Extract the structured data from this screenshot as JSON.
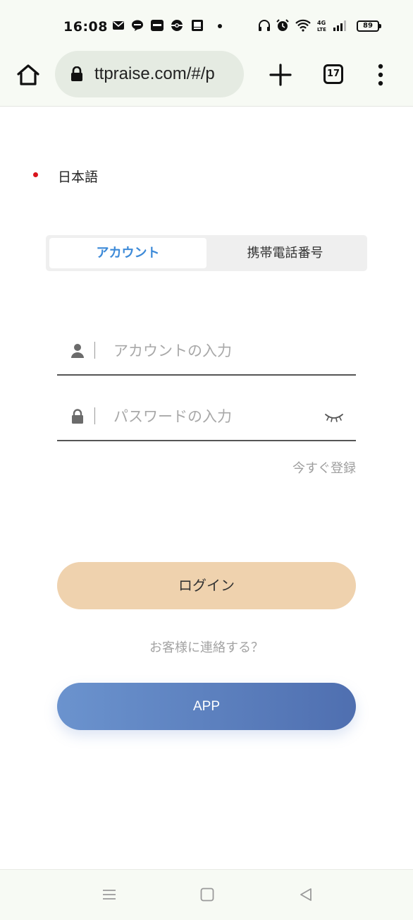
{
  "status_bar": {
    "time": "16:08",
    "battery": "89",
    "icons": [
      "mail-icon",
      "line-icon",
      "line-app-icon",
      "pokeball-icon",
      "gallery-icon",
      "headphones-icon",
      "alarm-icon",
      "wifi-icon",
      "volte-icon",
      "signal-icon",
      "battery-icon"
    ]
  },
  "browser": {
    "url": "ttpraise.com/#/p",
    "tab_count": "17",
    "icons": [
      "home-icon",
      "lock-icon",
      "plus-icon",
      "tabs-icon",
      "more-vert-icon"
    ]
  },
  "language": {
    "label": "日本語",
    "dot_color": "#d9141c"
  },
  "tabs": [
    {
      "label": "アカウント",
      "active": true
    },
    {
      "label": "携帯電話番号",
      "active": false
    }
  ],
  "form": {
    "account_placeholder": "アカウントの入力",
    "password_placeholder": "パスワードの入力",
    "register_link": "今すぐ登録",
    "login_button": "ログイン",
    "contact_link": "お客様に連絡する？",
    "app_button": "APP"
  },
  "colors": {
    "active_tab": "#3d8ad8",
    "login_button": "#efd2ae",
    "app_button_start": "#6b93ce",
    "app_button_end": "#4f6fb0"
  },
  "nav_bar": {
    "icons": [
      "menu-icon",
      "home-square-icon",
      "back-triangle-icon"
    ]
  }
}
